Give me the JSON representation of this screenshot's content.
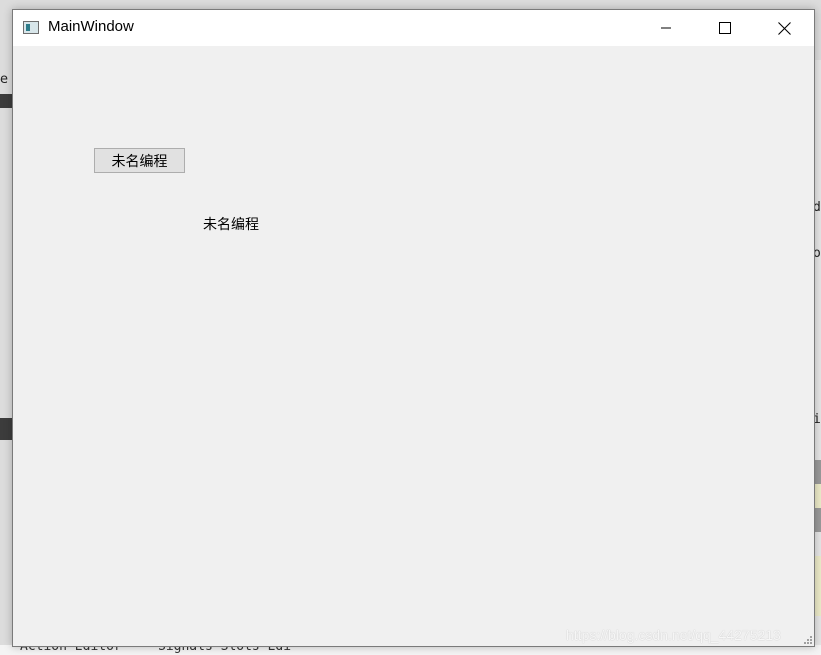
{
  "background": {
    "left_edge_text": "e",
    "right_texts": [
      "d",
      "o",
      "i"
    ],
    "bottom_tabs": [
      "Action Editor",
      "Signals  Slots Edi"
    ]
  },
  "window": {
    "title": "MainWindow",
    "icon": "qt-app-icon",
    "controls": {
      "minimize": "minimize-icon",
      "maximize": "maximize-icon",
      "close": "close-icon"
    }
  },
  "central": {
    "push_button_label": "未名编程",
    "label_text": "未名编程"
  },
  "watermark": "https://blog.csdn.net/qq_44275213"
}
